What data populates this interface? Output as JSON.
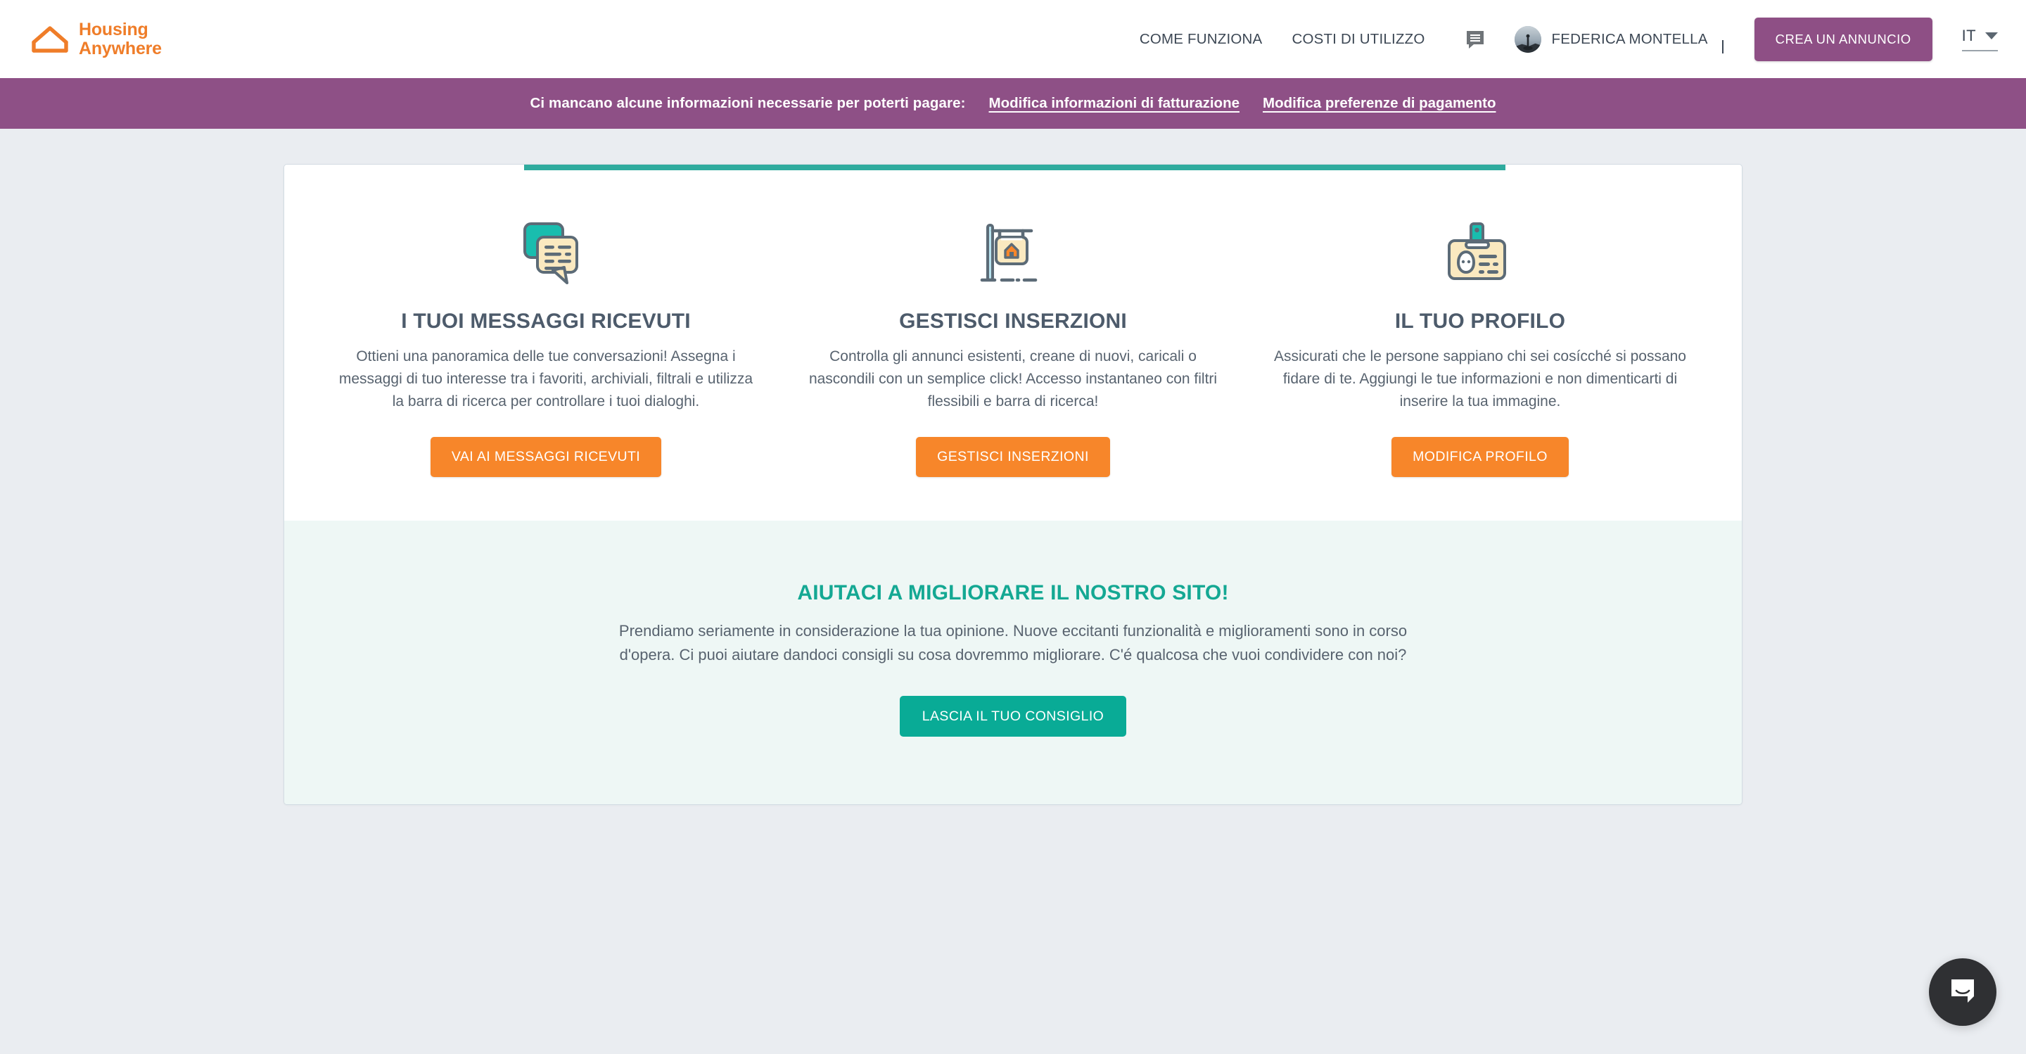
{
  "header": {
    "brand": {
      "line1": "Housing",
      "line2": "Anywhere",
      "logo_icon": "house-outline-icon",
      "color": "#ef7d29"
    },
    "nav": [
      {
        "label": "COME FUNZIONA",
        "name": "nav-come-funziona"
      },
      {
        "label": "COSTI DI UTILIZZO",
        "name": "nav-costi-di-utilizzo"
      }
    ],
    "messages_icon": "speech-bubble-icon",
    "user": {
      "name": "FEDERICA MONTELLA",
      "avatar_icon": "user-avatar-photo",
      "chevron_icon": "chevron-down-icon"
    },
    "cta": {
      "label": "CREA UN ANNUNCIO",
      "color": "#8e4f85"
    },
    "language": {
      "code": "IT",
      "chevron_icon": "triangle-down-icon"
    }
  },
  "alert": {
    "message": "Ci mancano alcune informazioni necessarie per poterti pagare:",
    "links": [
      {
        "label": "Modifica informazioni di fatturazione",
        "name": "alert-link-billing"
      },
      {
        "label": "Modifica preferenze di pagamento",
        "name": "alert-link-payment"
      }
    ],
    "background": "#8e5086"
  },
  "card": {
    "progress_color": "#2fab9e",
    "features": [
      {
        "icon": "chat-bubbles-icon",
        "title": "I TUOI MESSAGGI RICEVUTI",
        "description": "Ottieni una panoramica delle tue conversazioni! Assegna i messaggi di tuo interesse tra i favoriti, archiviali, filtrali e utilizza la barra di ricerca per controllare i tuoi dialoghi.",
        "button": "VAI AI MESSAGGI RICEVUTI"
      },
      {
        "icon": "for-rent-sign-icon",
        "title": "GESTISCI INSERZIONI",
        "description": "Controlla gli annunci esistenti, creane di nuovi, caricali o nascondili con un semplice click! Accesso instantaneo con filtri flessibili e barra di ricerca!",
        "button": "GESTISCI INSERZIONI"
      },
      {
        "icon": "id-badge-icon",
        "title": "IL TUO PROFILO",
        "description": "Assicurati che le persone sappiano chi sei cosícché si possano fidare di te. Aggiungi le tue informazioni e non dimenticarti di inserire la tua immagine.",
        "button": "MODIFICA PROFILO"
      }
    ],
    "button_color": "#f7862a"
  },
  "feedback": {
    "title": "AIUTACI A MIGLIORARE IL NOSTRO SITO!",
    "title_color": "#14a893",
    "description": "Prendiamo seriamente in considerazione la tua opinione. Nuove eccitanti funzionalità e miglioramenti sono in corso d'opera. Ci puoi aiutare dandoci consigli su cosa dovremmo migliorare. C'é qualcosa che vuoi condividere con noi?",
    "button": "LASCIA IL TUO CONSIGLIO",
    "button_color": "#09ab96",
    "background": "#eef7f5"
  },
  "chat_widget": {
    "icon": "intercom-chat-icon",
    "background": "#2f3033"
  }
}
